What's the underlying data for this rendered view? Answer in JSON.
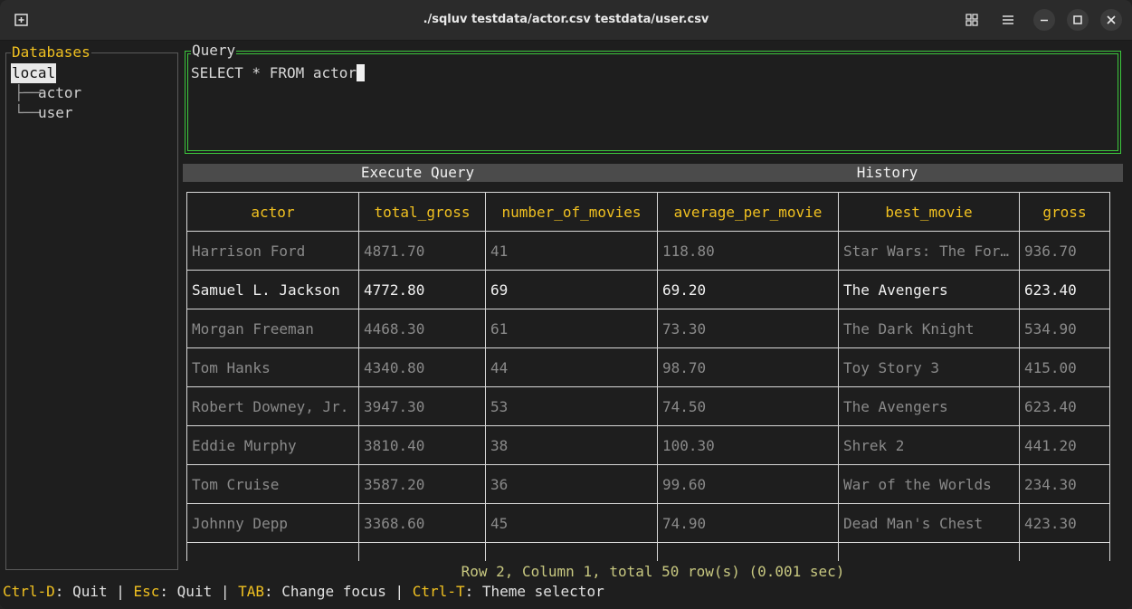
{
  "window": {
    "title": "./sqluv  testdata/actor.csv testdata/user.csv"
  },
  "sidebar": {
    "title": "Databases",
    "root": "local",
    "items": [
      {
        "label": "actor"
      },
      {
        "label": "user"
      }
    ]
  },
  "query": {
    "title": "Query",
    "text": "SELECT * FROM actor"
  },
  "buttons": {
    "execute": "Execute Query",
    "history": "History"
  },
  "table": {
    "columns": [
      "actor",
      "total_gross",
      "number_of_movies",
      "average_per_movie",
      "best_movie",
      "gross"
    ],
    "rows": [
      [
        "Harrison Ford",
        "4871.70",
        "41",
        "118.80",
        "Star Wars: The For…",
        "936.70"
      ],
      [
        "Samuel L. Jackson",
        "4772.80",
        "69",
        "69.20",
        "The Avengers",
        "623.40"
      ],
      [
        "Morgan Freeman",
        "4468.30",
        "61",
        "73.30",
        "The Dark Knight",
        "534.90"
      ],
      [
        "Tom Hanks",
        "4340.80",
        "44",
        "98.70",
        "Toy Story 3",
        "415.00"
      ],
      [
        "Robert Downey, Jr.",
        "3947.30",
        "53",
        "74.50",
        "The Avengers",
        "623.40"
      ],
      [
        "Eddie Murphy",
        "3810.40",
        "38",
        "100.30",
        "Shrek 2",
        "441.20"
      ],
      [
        "Tom Cruise",
        "3587.20",
        "36",
        "99.60",
        "War of the Worlds",
        "234.30"
      ],
      [
        "Johnny Depp",
        "3368.60",
        "45",
        "74.90",
        "Dead Man's Chest",
        "423.30"
      ]
    ],
    "selected_row": 1
  },
  "status": "Row 2, Column 1, total 50 row(s) (0.001 sec)",
  "footer": [
    {
      "key": "Ctrl-D",
      "action": ": Quit | "
    },
    {
      "key": "Esc",
      "action": ": Quit | "
    },
    {
      "key": "TAB",
      "action": ": Change focus | "
    },
    {
      "key": "Ctrl-T",
      "action": ": Theme selector"
    }
  ],
  "colors": {
    "accent": "#f0c020",
    "focus_border": "#3cc83c",
    "button_bar": "#4b4b4b"
  }
}
